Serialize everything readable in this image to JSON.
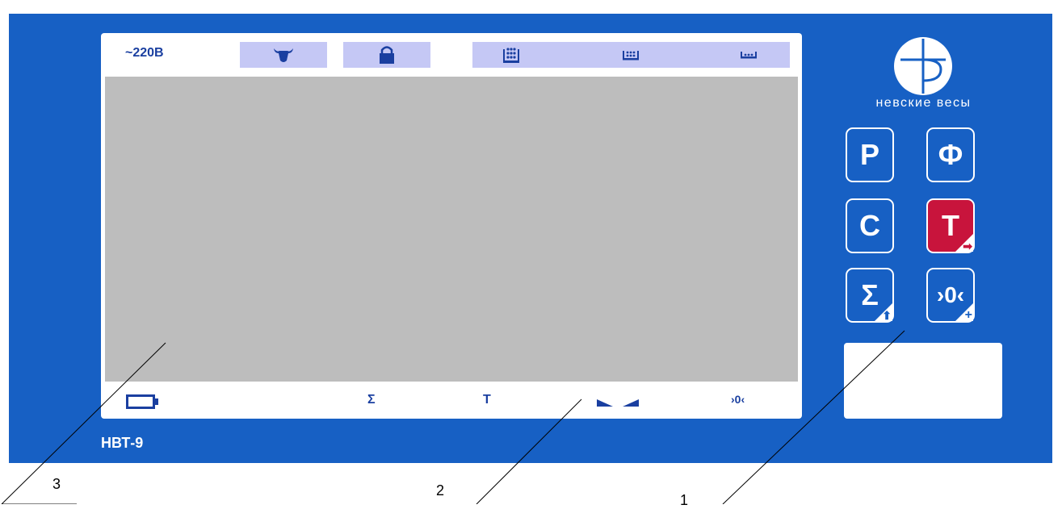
{
  "model_label": "НВТ-9",
  "brand": {
    "name": "невские весы"
  },
  "top_indicators": {
    "power_label": "~220В"
  },
  "bottom_indicators": {
    "sum": "Σ",
    "tare": "Т",
    "zero": "›0‹"
  },
  "keys": [
    {
      "label": "Р"
    },
    {
      "label": "Ф"
    },
    {
      "label": "С"
    },
    {
      "label": "Т",
      "corner": "➡"
    },
    {
      "label": "Σ",
      "corner": "⬆"
    },
    {
      "label": "›0‹",
      "corner": "+"
    }
  ],
  "callouts": {
    "c1": "1",
    "c2": "2",
    "c3": "3"
  },
  "colors": {
    "panel": "#1760c4",
    "display_screen": "#bdbdbd",
    "indicator_bg": "#c5c8f5",
    "tare_key": "#c8143c",
    "indicator_text": "#1a3fa0"
  }
}
